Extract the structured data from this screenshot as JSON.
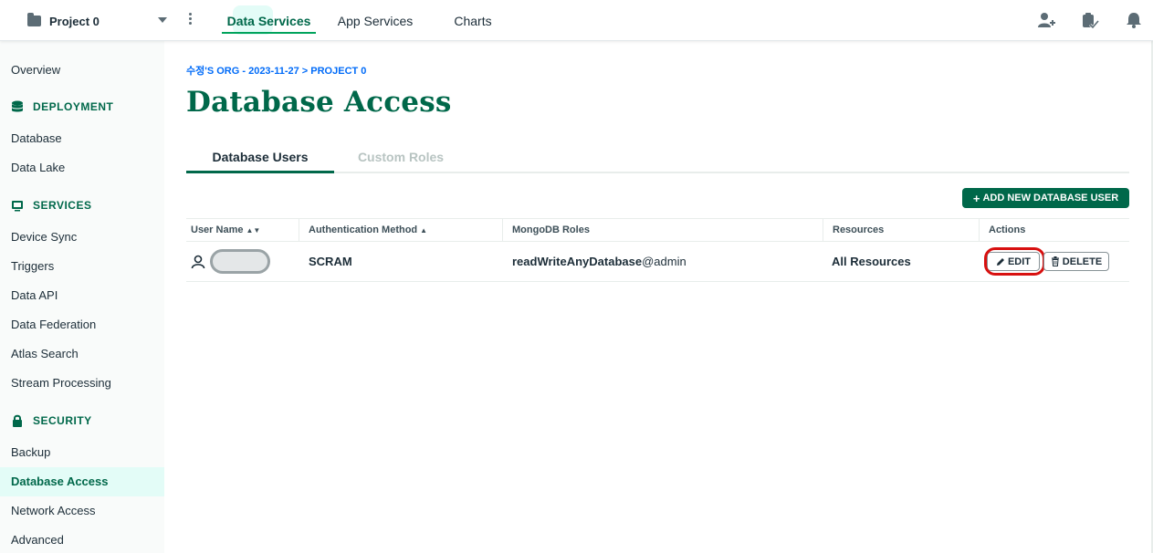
{
  "topbar": {
    "project_name": "Project 0",
    "nav": [
      "Data Services",
      "App Services",
      "Charts"
    ],
    "icons": [
      "invite-user-icon",
      "task-list-icon",
      "notifications-bell-icon"
    ]
  },
  "sidebar": {
    "overview": "Overview",
    "sections": [
      {
        "heading": "DEPLOYMENT",
        "icon": "database-icon",
        "items": [
          "Database",
          "Data Lake"
        ]
      },
      {
        "heading": "SERVICES",
        "icon": "services-icon",
        "items": [
          "Device Sync",
          "Triggers",
          "Data API",
          "Data Federation",
          "Atlas Search",
          "Stream Processing"
        ]
      },
      {
        "heading": "SECURITY",
        "icon": "lock-icon",
        "items": [
          "Backup",
          "Database Access",
          "Network Access",
          "Advanced"
        ]
      }
    ],
    "active_item": "Database Access"
  },
  "main": {
    "breadcrumb": "수정'S ORG - 2023-11-27 > PROJECT 0",
    "title": "Database Access",
    "tabs": [
      "Database Users",
      "Custom Roles"
    ],
    "add_button": "ADD NEW DATABASE USER",
    "table": {
      "headers": [
        "User Name",
        "Authentication Method",
        "MongoDB Roles",
        "Resources",
        "Actions"
      ],
      "rows": [
        {
          "username": "",
          "auth": "SCRAM",
          "role": "readWriteAnyDatabase",
          "role_db": "@admin",
          "resources": "All Resources"
        }
      ],
      "edit_label": "EDIT",
      "delete_label": "DELETE"
    }
  },
  "colors": {
    "brand_green": "#00684a",
    "accent_green": "#00a35c",
    "link_blue": "#016bf8",
    "highlight_red": "#d8100f"
  }
}
